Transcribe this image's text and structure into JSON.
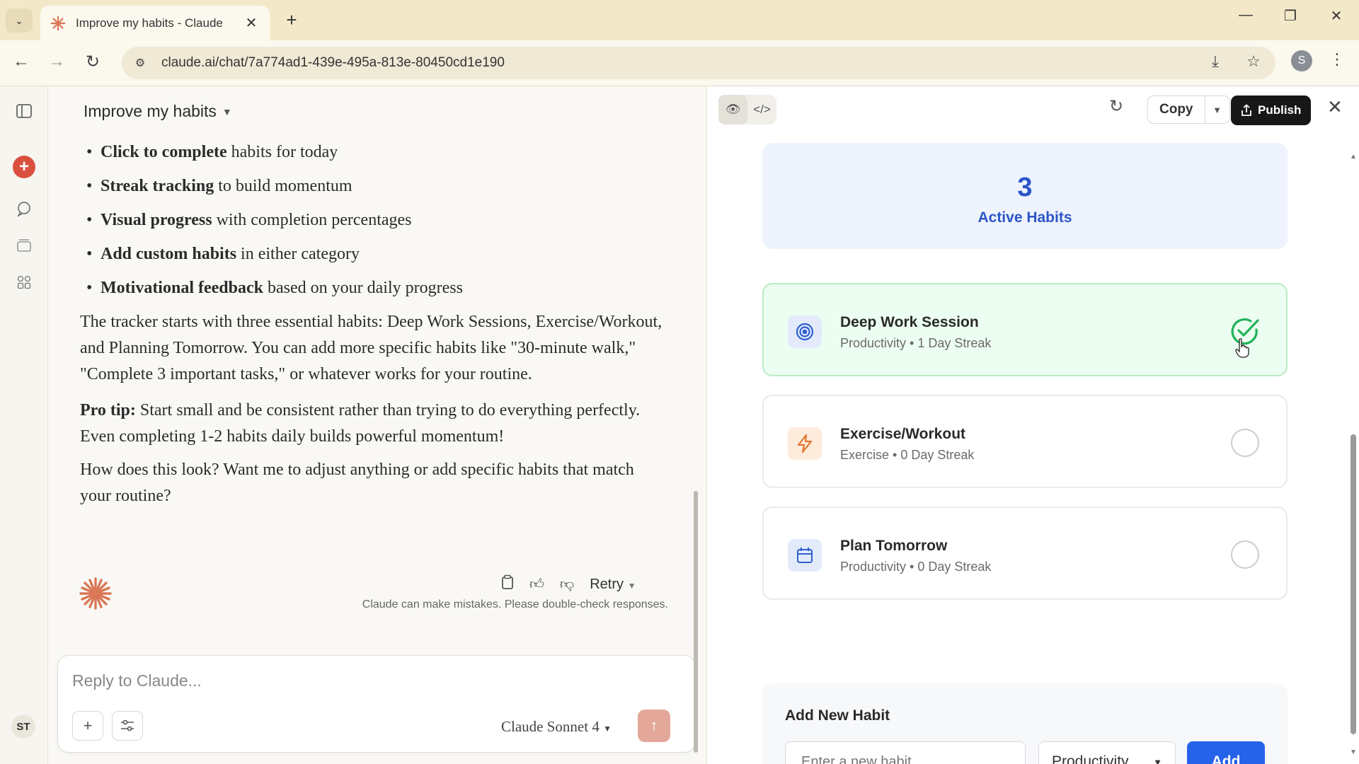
{
  "browser": {
    "tab_title": "Improve my habits - Claude",
    "url": "claude.ai/chat/7a774ad1-439e-495a-813e-80450cd1e190",
    "profile_initial": "S"
  },
  "rail": {
    "avatar_initials": "ST"
  },
  "chat": {
    "title": "Improve my habits",
    "bullets": [
      {
        "bold": "Click to complete",
        "rest": " habits for today"
      },
      {
        "bold": "Streak tracking",
        "rest": " to build momentum"
      },
      {
        "bold": "Visual progress",
        "rest": " with completion percentages"
      },
      {
        "bold": "Add custom habits",
        "rest": " in either category"
      },
      {
        "bold": "Motivational feedback",
        "rest": " based on your daily progress"
      }
    ],
    "paragraph1": "The tracker starts with three essential habits: Deep Work Sessions, Exercise/Workout, and Planning Tomorrow. You can add more specific habits like \"30-minute walk,\" \"Complete 3 important tasks,\" or whatever works for your routine.",
    "protip_label": "Pro tip:",
    "protip_text": " Start small and be consistent rather than trying to do everything perfectly. Even completing 1-2 habits daily builds powerful momentum!",
    "paragraph3": "How does this look? Want me to adjust anything or add specific habits that match your routine?",
    "retry_label": "Retry",
    "disclaimer": "Claude can make mistakes. Please double-check responses.",
    "composer_placeholder": "Reply to Claude...",
    "model": "Claude Sonnet 4"
  },
  "artifact": {
    "copy_label": "Copy",
    "publish_label": "Publish",
    "stat_value": "3",
    "stat_label": "Active Habits",
    "habits": [
      {
        "name": "Deep Work Session",
        "meta": "Productivity • 1 Day Streak",
        "done": true,
        "icon": "target-icon",
        "icon_bg": "#e3ebfb",
        "icon_color": "#2f5fd0"
      },
      {
        "name": "Exercise/Workout",
        "meta": "Exercise • 0 Day Streak",
        "done": false,
        "icon": "lightning-icon",
        "icon_bg": "#fdebdc",
        "icon_color": "#e5772e"
      },
      {
        "name": "Plan Tomorrow",
        "meta": "Productivity • 0 Day Streak",
        "done": false,
        "icon": "calendar-icon",
        "icon_bg": "#e3ebfb",
        "icon_color": "#2f5fd0"
      }
    ],
    "add_title": "Add New Habit",
    "add_placeholder": "Enter a new habit...",
    "category_selected": "Productivity",
    "add_button": "Add",
    "done_color": "#22b35a"
  }
}
